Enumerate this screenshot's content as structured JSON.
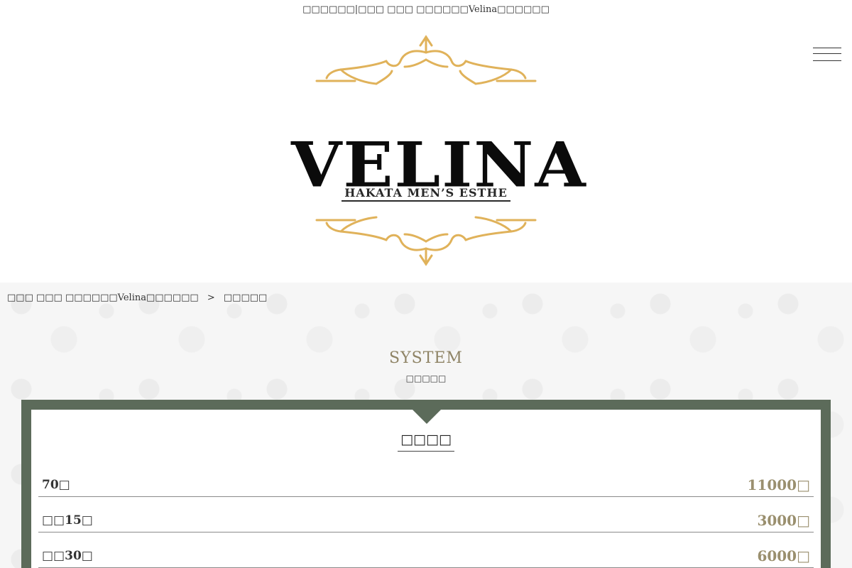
{
  "header": {
    "page_title": "□□□□□□|□□□ □□□ □□□□□□Velina□□□□□□",
    "menu_icon": "hamburger-icon"
  },
  "logo": {
    "brand": "VELINA",
    "tagline": "HAKATA MEN’S ESTHE",
    "ornament_color": "#e0b25a"
  },
  "breadcrumb": {
    "home": "□□□ □□□ □□□□□□Velina□□□□□□",
    "separator": ">",
    "current": "□□□□□"
  },
  "section": {
    "title": "SYSTEM",
    "subtitle": "□□□□□"
  },
  "price_panel": {
    "heading": "□□□□",
    "rows": [
      {
        "label": "70□",
        "value": "11000□"
      },
      {
        "label": "□□15□",
        "value": "3000□"
      },
      {
        "label": "□□30□",
        "value": "6000□"
      }
    ]
  },
  "colors": {
    "accent_gold": "#9a8f6e",
    "frame_green": "#5c6b5a",
    "title_gold": "#8f8466"
  }
}
